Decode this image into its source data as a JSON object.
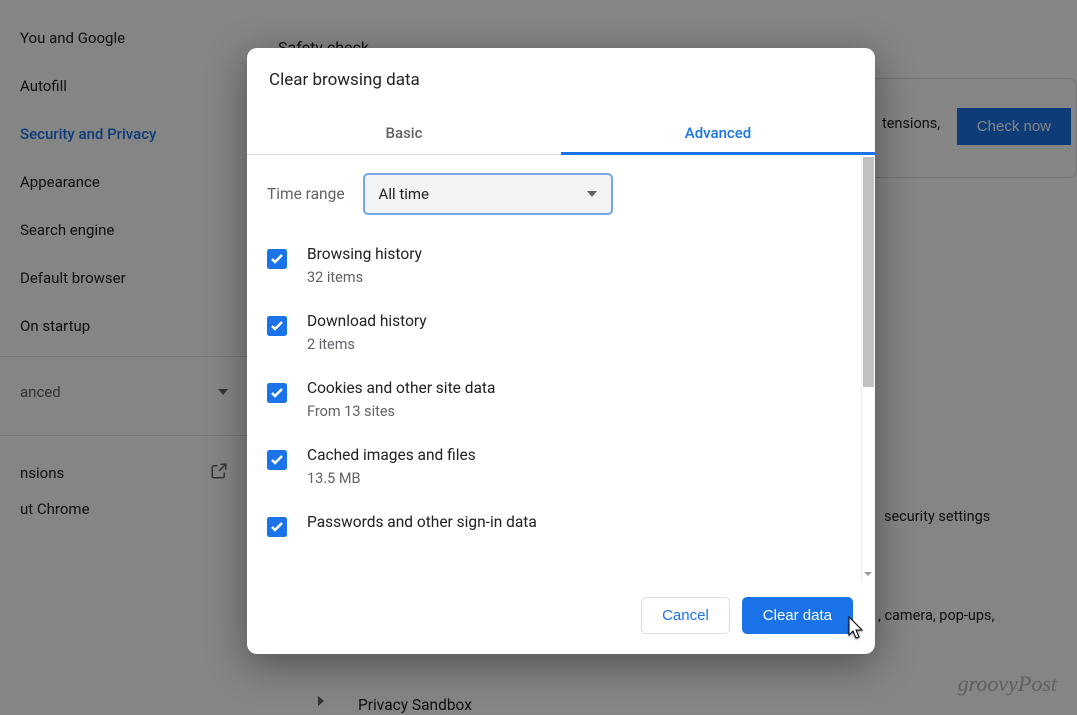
{
  "sidebar": {
    "items": [
      {
        "label": "You and Google"
      },
      {
        "label": "Autofill"
      },
      {
        "label": "Security and Privacy",
        "active": true
      },
      {
        "label": "Appearance"
      },
      {
        "label": "Search engine"
      },
      {
        "label": "Default browser"
      },
      {
        "label": "On startup"
      }
    ],
    "advanced": "anced",
    "extensions": "nsions",
    "about": "ut Chrome"
  },
  "background": {
    "safety_check": "Safety check",
    "extensions_snip": "tensions,",
    "check_now": "Check now",
    "security_snippet": "security settings",
    "camera_snippet": ", camera, pop-ups,",
    "privacy_sandbox": "Privacy Sandbox"
  },
  "dialog": {
    "title": "Clear browsing data",
    "tabs": {
      "basic": "Basic",
      "advanced": "Advanced"
    },
    "time_range": {
      "label": "Time range",
      "value": "All time"
    },
    "items": [
      {
        "title": "Browsing history",
        "sub": "32 items"
      },
      {
        "title": "Download history",
        "sub": "2 items"
      },
      {
        "title": "Cookies and other site data",
        "sub": "From 13 sites"
      },
      {
        "title": "Cached images and files",
        "sub": "13.5 MB"
      },
      {
        "title": "Passwords and other sign-in data",
        "sub": ""
      }
    ],
    "buttons": {
      "cancel": "Cancel",
      "confirm": "Clear data"
    }
  },
  "watermark": "groovyPost"
}
